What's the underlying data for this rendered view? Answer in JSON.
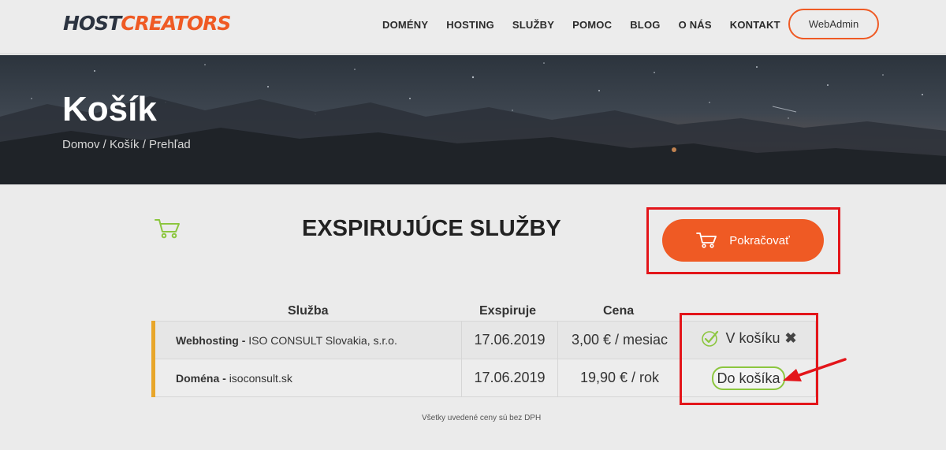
{
  "header": {
    "logo_host": "HOST",
    "logo_creators": "CREATORS",
    "nav": [
      "DOMÉNY",
      "HOSTING",
      "SLUŽBY",
      "POMOC",
      "BLOG",
      "O NÁS",
      "KONTAKT"
    ],
    "webadmin_label": "WebAdmin"
  },
  "hero": {
    "title": "Košík",
    "breadcrumb": "Domov / Košík / Prehľad"
  },
  "main": {
    "title": "EXSPIRUJÚCE SLUŽBY",
    "continue_label": "Pokračovať",
    "columns": {
      "service": "Služba",
      "expires": "Exspiruje",
      "price": "Cena"
    },
    "rows": [
      {
        "type": "Webhosting -",
        "name": "ISO CONSULT Slovakia, s.r.o.",
        "expires": "17.06.2019",
        "price": "3,00 € / mesiac",
        "action": "V košíku",
        "in_cart": true
      },
      {
        "type": "Doména -",
        "name": "isoconsult.sk",
        "expires": "17.06.2019",
        "price": "19,90 € / rok",
        "action": "Do košíka",
        "in_cart": false
      }
    ],
    "note": "Všetky uvedené ceny sú bez DPH"
  },
  "colors": {
    "accent": "#ef5a24",
    "highlight_box": "#e3151a",
    "row_marker": "#e8a62a",
    "success": "#8cc63f",
    "logo_dark": "#2b3340"
  },
  "icons": {
    "cart": "cart-icon",
    "check": "check-circle-icon",
    "remove": "close-icon",
    "annotation": "arrow-icon"
  }
}
